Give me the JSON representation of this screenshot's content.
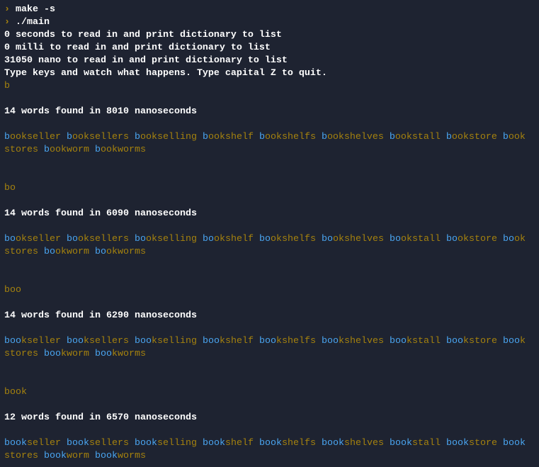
{
  "colors": {
    "background": "#1e2331",
    "prompt": "#a5820e",
    "match": "#4aa5f0",
    "rest": "#a5820e",
    "text": "#ffffff"
  },
  "prompt_icon": "prompt-chevron-icon",
  "commands": [
    "make -s",
    "./main"
  ],
  "output_lines": [
    "0 seconds to read in and print dictionary to list",
    "0 milli to read in and print dictionary to list",
    "31050 nano to read in and print dictionary to list",
    "Type keys and watch what happens. Type capital Z to quit."
  ],
  "queries": [
    {
      "input": "b",
      "result": "14 words found in 8010 nanoseconds",
      "words": [
        "bookseller",
        "booksellers",
        "bookselling",
        "bookshelf",
        "bookshelfs",
        "bookshelves",
        "bookstall",
        "bookstore",
        "bookstores",
        "bookworm",
        "bookworms"
      ]
    },
    {
      "input": "bo",
      "result": "14 words found in 6090 nanoseconds",
      "words": [
        "bookseller",
        "booksellers",
        "bookselling",
        "bookshelf",
        "bookshelfs",
        "bookshelves",
        "bookstall",
        "bookstore",
        "bookstores",
        "bookworm",
        "bookworms"
      ]
    },
    {
      "input": "boo",
      "result": "14 words found in 6290 nanoseconds",
      "words": [
        "bookseller",
        "booksellers",
        "bookselling",
        "bookshelf",
        "bookshelfs",
        "bookshelves",
        "bookstall",
        "bookstore",
        "bookstores",
        "bookworm",
        "bookworms"
      ]
    },
    {
      "input": "book",
      "result": "12 words found in 6570 nanoseconds",
      "words": [
        "bookseller",
        "booksellers",
        "bookselling",
        "bookshelf",
        "bookshelfs",
        "bookshelves",
        "bookstall",
        "bookstore",
        "bookstores",
        "bookworm",
        "bookworms"
      ]
    }
  ]
}
